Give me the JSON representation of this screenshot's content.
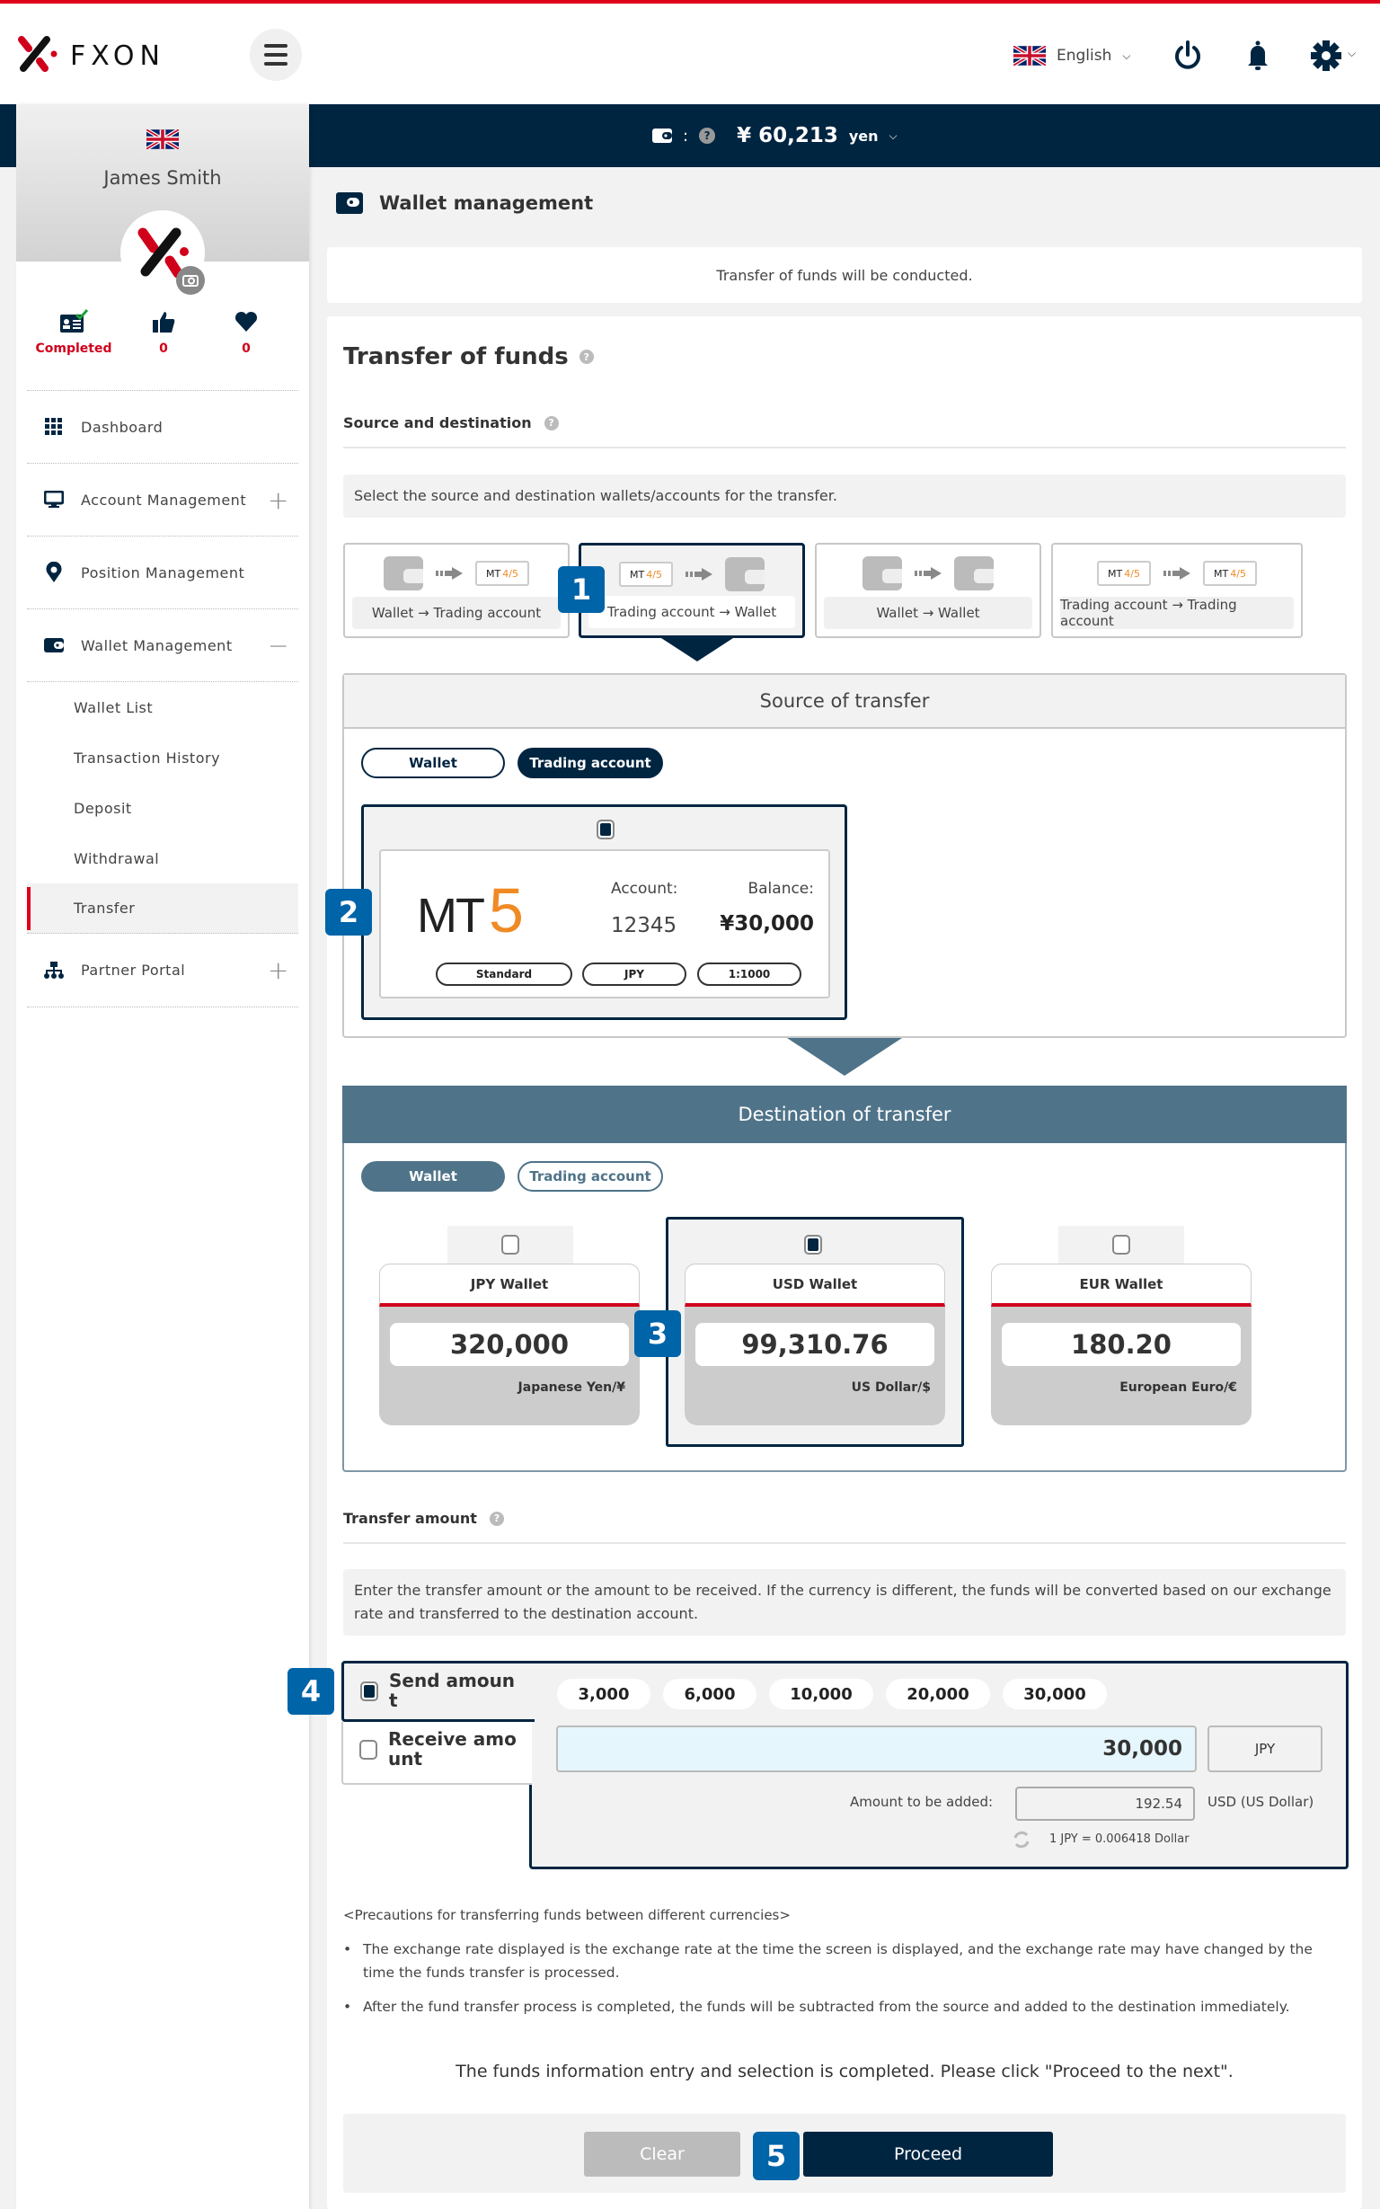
{
  "header": {
    "brand": "FXON",
    "language": "English",
    "icons": [
      "menu-icon",
      "uk-flag-icon",
      "power-icon",
      "bell-icon",
      "gear-icon"
    ]
  },
  "balance_bar": {
    "separator": ":",
    "amount": "¥ 60,213",
    "unit": "yen"
  },
  "sidebar": {
    "user_name": "James Smith",
    "stats": [
      {
        "icon": "id-card-check-icon",
        "label": "Completed"
      },
      {
        "icon": "thumbs-up-icon",
        "label": "0"
      },
      {
        "icon": "heart-icon",
        "label": "0"
      }
    ],
    "nav": [
      {
        "icon": "grid-icon",
        "label": "Dashboard",
        "toggle": ""
      },
      {
        "icon": "monitor-icon",
        "label": "Account Management",
        "toggle": "+"
      },
      {
        "icon": "location-pin-icon",
        "label": "Position Management",
        "toggle": ""
      },
      {
        "icon": "wallet-icon",
        "label": "Wallet Management",
        "toggle": "−"
      }
    ],
    "sub_nav": [
      "Wallet List",
      "Transaction History",
      "Deposit",
      "Withdrawal",
      "Transfer"
    ],
    "active_sub": "Transfer",
    "partner": {
      "icon": "org-chart-icon",
      "label": "Partner Portal",
      "toggle": "+"
    }
  },
  "main": {
    "page_title": "Wallet management",
    "notice": "Transfer of funds will be conducted.",
    "section_title": "Transfer of funds",
    "source_dest_title": "Source and destination",
    "source_dest_info": "Select the source and destination wallets/accounts for the transfer.",
    "transfer_types": [
      {
        "label": "Wallet → Trading account",
        "selected": false
      },
      {
        "label": "Trading account → Wallet",
        "selected": true
      },
      {
        "label": "Wallet → Wallet",
        "selected": false
      },
      {
        "label": "Trading account → Trading account",
        "selected": false
      }
    ],
    "mt_icon_text": "MT",
    "mt_icon_versions": "4/5",
    "source": {
      "title": "Source of transfer",
      "tabs": [
        "Wallet",
        "Trading account"
      ],
      "active_tab": "Trading account",
      "account": {
        "platform_prefix": "MT",
        "platform_version": "5",
        "account_label": "Account:",
        "account_number": "12345",
        "balance_label": "Balance:",
        "balance": "¥30,000",
        "tags": [
          "Standard",
          "JPY",
          "1:1000"
        ],
        "checked": true
      }
    },
    "destination": {
      "title": "Destination of transfer",
      "tabs": [
        "Wallet",
        "Trading account"
      ],
      "active_tab": "Wallet",
      "wallets": [
        {
          "name": "JPY Wallet",
          "balance": "320,000",
          "currency": "Japanese Yen/¥",
          "checked": false
        },
        {
          "name": "USD Wallet",
          "balance": "99,310.76",
          "currency": "US Dollar/$",
          "checked": true
        },
        {
          "name": "EUR Wallet",
          "balance": "180.20",
          "currency": "European Euro/€",
          "checked": false
        }
      ]
    },
    "amount": {
      "title": "Transfer amount",
      "info": "Enter the transfer amount or the amount to be received. If the currency is different, the funds will be converted based on our exchange rate and transferred to the destination account.",
      "modes": [
        {
          "label": "Send amoun t",
          "checked": true
        },
        {
          "label": "Receive amo unt",
          "checked": false
        }
      ],
      "quick_amounts": [
        "3,000",
        "6,000",
        "10,000",
        "20,000",
        "30,000"
      ],
      "value": "30,000",
      "currency": "JPY",
      "added_label": "Amount to be added:",
      "added_value": "192.54",
      "added_currency": "USD (US Dollar)",
      "rate": "1 JPY = 0.006418 Dollar"
    },
    "precautions": {
      "title": "<Precautions for transferring funds between different currencies>",
      "items": [
        "The exchange rate displayed is the exchange rate at the time the screen is displayed, and the exchange rate may have changed by the time the funds transfer is processed.",
        "After the fund transfer process is completed, the funds will be subtracted from the source and added to the destination immediately."
      ]
    },
    "completion_message": "The funds information entry and selection is completed. Please click \"Proceed to the next\".",
    "buttons": {
      "clear": "Clear",
      "proceed": "Proceed"
    },
    "step_badges": [
      "1",
      "2",
      "3",
      "4",
      "5"
    ]
  },
  "colors": {
    "navy": "#002541",
    "accent_red": "#e0001b",
    "badge_blue": "#0064a8",
    "dest_header": "#4f7389",
    "mt5_orange": "#f08a24"
  }
}
